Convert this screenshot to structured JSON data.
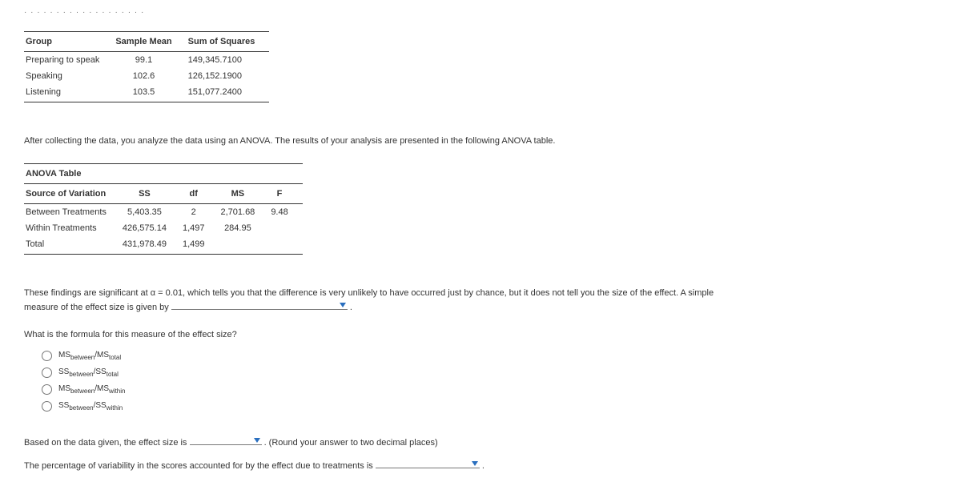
{
  "crumb": "· · · · · · · · · · · · · · · · · · ·",
  "table1": {
    "headers": [
      "Group",
      "Sample Mean",
      "Sum of Squares"
    ],
    "rows": [
      [
        "Preparing to speak",
        "99.1",
        "149,345.7100"
      ],
      [
        "Speaking",
        "102.6",
        "126,152.1900"
      ],
      [
        "Listening",
        "103.5",
        "151,077.2400"
      ]
    ]
  },
  "intro": "After collecting the data, you analyze the data using an ANOVA. The results of your analysis are presented in the following ANOVA table.",
  "anova": {
    "title": "ANOVA Table",
    "headers": [
      "Source of Variation",
      "SS",
      "df",
      "MS",
      "F"
    ],
    "rows": [
      [
        "Between Treatments",
        "5,403.35",
        "2",
        "2,701.68",
        "9.48"
      ],
      [
        "Within Treatments",
        "426,575.14",
        "1,497",
        "284.95",
        ""
      ],
      [
        "Total",
        "431,978.49",
        "1,499",
        "",
        ""
      ]
    ]
  },
  "para2a": "These findings are significant at α = 0.01, which tells you that the difference is very unlikely to have occurred just by chance, but it does not tell you the size of the effect. A simple measure of the effect size is given by ",
  "para2b": " .",
  "q_formula": "What is the formula for this measure of the effect size?",
  "options": {
    "a": {
      "n": "MS",
      "s1": "between",
      "d": "/MS",
      "s2": "total"
    },
    "b": {
      "n": "SS",
      "s1": "between",
      "d": "/SS",
      "s2": "total"
    },
    "c": {
      "n": "MS",
      "s1": "between",
      "d": "/MS",
      "s2": "within"
    },
    "d": {
      "n": "SS",
      "s1": "between",
      "d": "/SS",
      "s2": "within"
    }
  },
  "q_effect_a": "Based on the data given, the effect size is ",
  "q_effect_b": " . (Round your answer to two decimal places)",
  "q_pct_a": "The percentage of variability in the scores accounted for by the effect due to treatments is ",
  "q_pct_b": " ."
}
